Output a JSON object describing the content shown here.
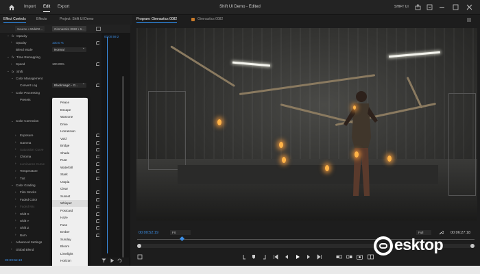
{
  "topbar": {
    "menu": [
      "Import",
      "Edit",
      "Export"
    ],
    "active_menu": "Edit",
    "title": "Shift UI Demo - Edited",
    "workspace": "SHIFT UI"
  },
  "panels": {
    "effect_controls_tab": "Effect Controls",
    "effects_tab": "Effects",
    "project_tab": "Project: Shift UI Demo"
  },
  "ec": {
    "source_chip": "Source • 60dd02...",
    "clip_chip": "Gimnastics 0082 • 6...",
    "timecode_top": "00:00:59:2",
    "rows": [
      {
        "indent": 1,
        "chev": "v",
        "fx": true,
        "label": "Opacity"
      },
      {
        "indent": 2,
        "chev": ">",
        "label": "Opacity",
        "value": "100.0 %",
        "blue": true,
        "reset": true
      },
      {
        "indent": 2,
        "chev": "",
        "label": "Blend Mode",
        "dropdown": "Normal"
      },
      {
        "indent": 1,
        "chev": "v",
        "fx": true,
        "label": "Time Remapping"
      },
      {
        "indent": 2,
        "chev": ">",
        "label": "Speed",
        "value": "100.00%",
        "reset": true
      },
      {
        "indent": 1,
        "chev": "v",
        "fx": true,
        "label": "Shift"
      },
      {
        "indent": 2,
        "chev": "v",
        "label": "Color Management"
      },
      {
        "indent": 3,
        "chev": "",
        "label": "Convert Log",
        "dropdown": "Blackmagic - G...",
        "reset": true
      },
      {
        "indent": 2,
        "chev": "v",
        "label": "Color Processing"
      },
      {
        "indent": 3,
        "chev": "",
        "label": "Presets",
        "dropdown": "Custom",
        "open": true
      },
      {
        "indent": 0,
        "chev": "",
        "label": ""
      },
      {
        "indent": 0,
        "chev": "",
        "label": ""
      },
      {
        "indent": 2,
        "chev": "v",
        "label": "Color Correction"
      },
      {
        "indent": 0,
        "chev": "",
        "label": ""
      },
      {
        "indent": 3,
        "chev": ">",
        "label": "Exposure",
        "reset": true
      },
      {
        "indent": 3,
        "chev": ">",
        "label": "Gamma",
        "reset": true
      },
      {
        "indent": 3,
        "chev": ">",
        "label": "Saturation Curve",
        "dim": true,
        "reset": true
      },
      {
        "indent": 3,
        "chev": ">",
        "label": "Chroma",
        "reset": true
      },
      {
        "indent": 3,
        "chev": ">",
        "label": "Luminance Curve",
        "dim": true,
        "reset": true
      },
      {
        "indent": 3,
        "chev": ">",
        "label": "Temperature",
        "reset": true
      },
      {
        "indent": 3,
        "chev": ">",
        "label": "Tint",
        "reset": true
      },
      {
        "indent": 2,
        "chev": "v",
        "label": "Color Grading"
      },
      {
        "indent": 3,
        "chev": ">",
        "label": "Film Stocks",
        "reset": true
      },
      {
        "indent": 3,
        "chev": ">",
        "label": "Faded Color",
        "reset": true
      },
      {
        "indent": 3,
        "chev": ">",
        "label": "Faded Mix",
        "dim": true,
        "reset": true
      },
      {
        "indent": 3,
        "chev": ">",
        "label": "Shift X",
        "reset": true
      },
      {
        "indent": 3,
        "chev": ">",
        "label": "Shift Y",
        "reset": true
      },
      {
        "indent": 3,
        "chev": ">",
        "label": "Shift Z",
        "reset": true
      },
      {
        "indent": 3,
        "chev": ">",
        "label": "Burn",
        "reset": true
      },
      {
        "indent": 2,
        "chev": ">",
        "label": "Advanced Settings"
      },
      {
        "indent": 2,
        "chev": ">",
        "label": "Global Blend"
      }
    ],
    "timecode_bottom": "00:00:52:19"
  },
  "presets_list": {
    "items": [
      "Peace",
      "Escape",
      "Warzone",
      "Drive",
      "Hometown",
      "Void",
      "Bridge",
      "Shade",
      "Rust",
      "Waterfall",
      "Stark",
      "Utopia",
      "Clear",
      "Sunset",
      "Whisper",
      "Postcard",
      "Haze",
      "Fuse",
      "Ember",
      "Sunday",
      "Bloom",
      "Limelight",
      "Horizon"
    ],
    "hovered": "Whisper"
  },
  "program": {
    "tab_label": "Program: Gimnastics 0082",
    "second_tab": "Gimnastics 0082",
    "timecode_current": "00:00:52:19",
    "fit_label": "Fit",
    "quality_label": "Full",
    "timecode_duration": "00:06:27:18"
  },
  "watermark": {
    "text": "esktop"
  }
}
